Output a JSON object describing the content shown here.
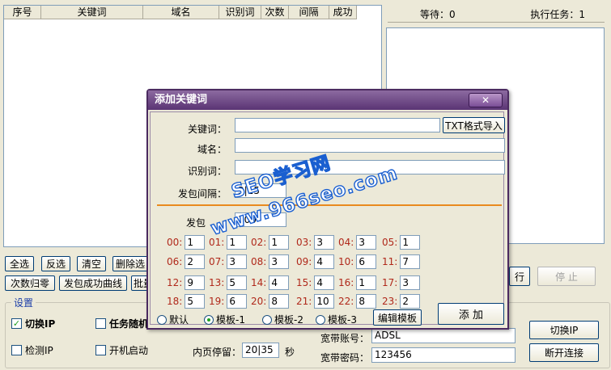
{
  "grid": {
    "columns": [
      "序号",
      "关键词",
      "域名",
      "识别词",
      "次数",
      "间隔",
      "成功"
    ]
  },
  "status": {
    "waiting": "等待：0",
    "tasks": "执行任务：1"
  },
  "buttons": {
    "select_all": "全选",
    "invert": "反选",
    "clear": "清空",
    "delete_sel": "删除选",
    "reset_count": "次数归零",
    "curve": "发包成功曲线",
    "batch": "批量",
    "start_partial": "行",
    "stop": "停 止"
  },
  "settings": {
    "title": "设置",
    "switch_ip": "切换IP",
    "random_task": "任务随机",
    "detect_ip": "检测IP",
    "autostart": "开机启动",
    "stay_label": "内页停留：",
    "stay_value": "20|35",
    "stay_unit": "秒",
    "account_label": "宽带账号：",
    "account_value": "ADSL",
    "password_label": "宽带密码：",
    "password_value": "123456",
    "switch_ip_btn": "切换IP",
    "disconnect_btn": "断开连接"
  },
  "dialog": {
    "title": "添加关键词",
    "close": "✕",
    "keyword_label": "关键词：",
    "keyword_value": "",
    "domain_label": "域名：",
    "domain_value": "",
    "identifier_label": "识别词：",
    "identifier_value": "",
    "interval_label": "发包间隔：",
    "interval_value": "3|15",
    "count_label": "发包",
    "count_value": "100",
    "import_btn": "TXT格式导入",
    "slots": [
      {
        "label": "00:",
        "value": "1"
      },
      {
        "label": "01:",
        "value": "1"
      },
      {
        "label": "02:",
        "value": "1"
      },
      {
        "label": "03:",
        "value": "3"
      },
      {
        "label": "04:",
        "value": "3"
      },
      {
        "label": "05:",
        "value": "1"
      },
      {
        "label": "06:",
        "value": "2"
      },
      {
        "label": "07:",
        "value": "3"
      },
      {
        "label": "08:",
        "value": "3"
      },
      {
        "label": "09:",
        "value": "4"
      },
      {
        "label": "10:",
        "value": "6"
      },
      {
        "label": "11:",
        "value": "7"
      },
      {
        "label": "12:",
        "value": "9"
      },
      {
        "label": "13:",
        "value": "5"
      },
      {
        "label": "14:",
        "value": "4"
      },
      {
        "label": "15:",
        "value": "4"
      },
      {
        "label": "16:",
        "value": "1"
      },
      {
        "label": "17:",
        "value": "3"
      },
      {
        "label": "18:",
        "value": "5"
      },
      {
        "label": "19:",
        "value": "6"
      },
      {
        "label": "20:",
        "value": "8"
      },
      {
        "label": "21:",
        "value": "10"
      },
      {
        "label": "22:",
        "value": "8"
      },
      {
        "label": "23:",
        "value": "2"
      }
    ],
    "radios": [
      "默认",
      "模板-1",
      "模板-2",
      "模板-3"
    ],
    "selected_radio": "模板-1",
    "edit_template": "编辑模板",
    "add": "添 加"
  },
  "watermark": {
    "line1": "SEO学习网",
    "line2": "www.966seo.com"
  }
}
